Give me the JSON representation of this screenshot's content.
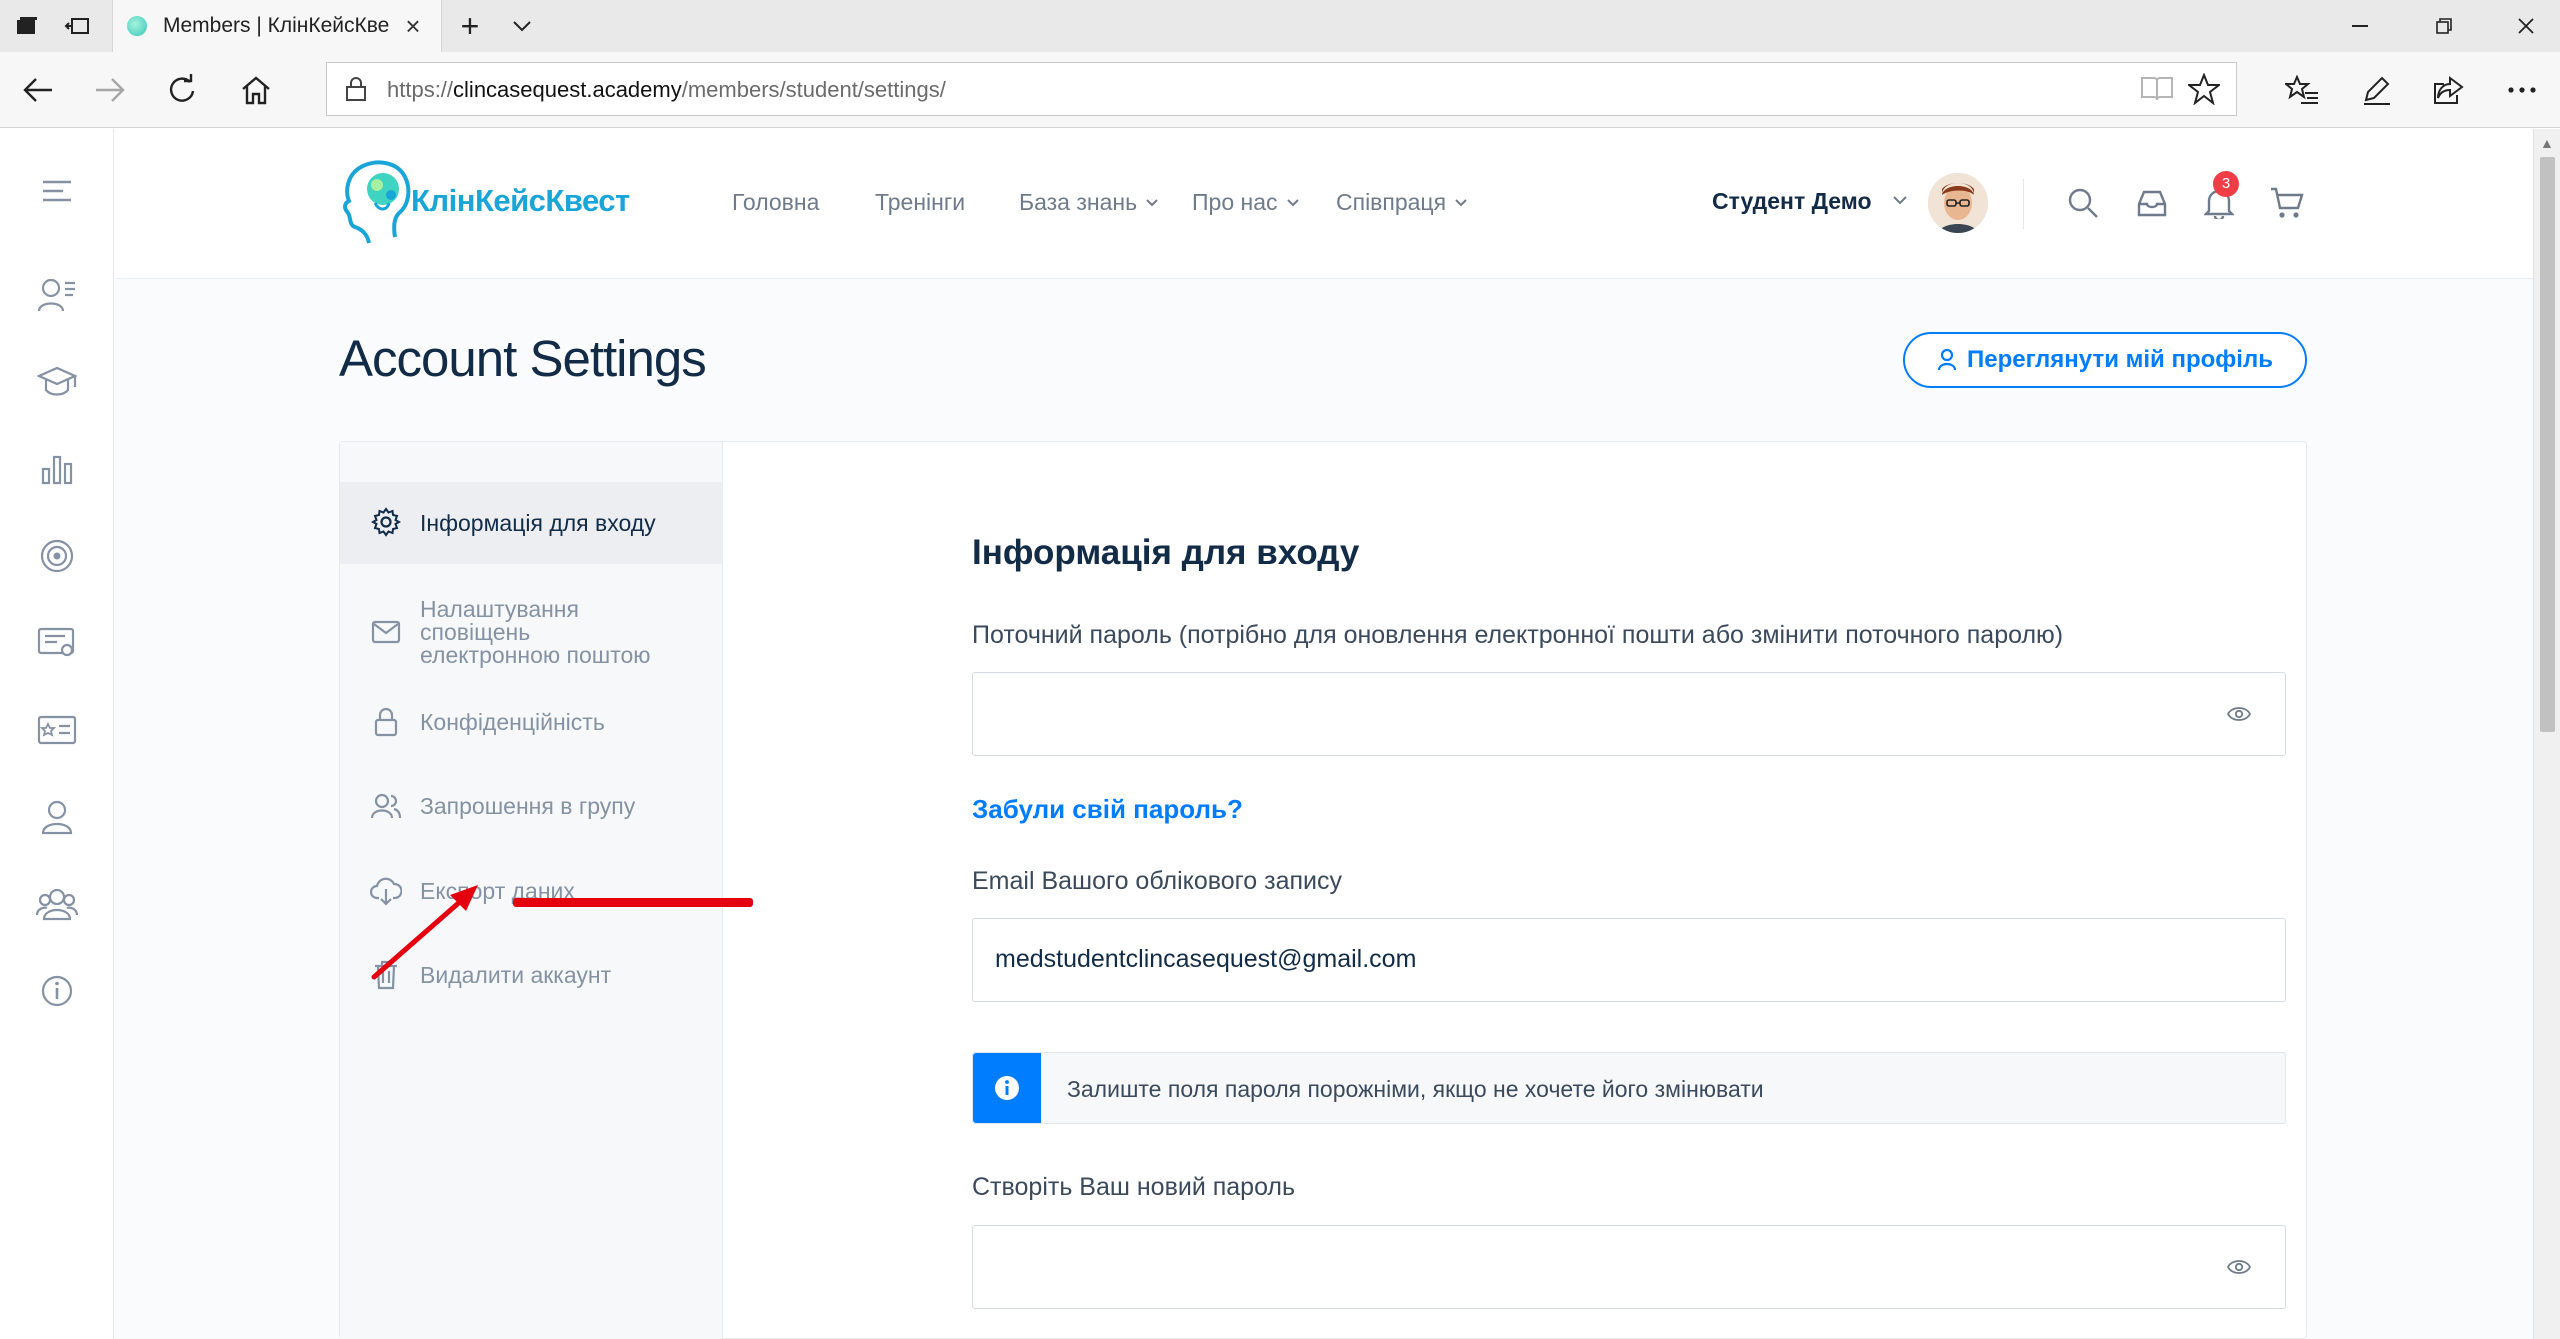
{
  "browser": {
    "tab_title": "Members | КлінКейсКве",
    "tab_close": "×",
    "new_tab": "+",
    "url_prefix": "https://",
    "url_domain": "clincasequest.academy",
    "url_path": "/members/student/settings/"
  },
  "site": {
    "logo_text": "КлінКейсКвест",
    "nav": [
      {
        "label": "Головна",
        "has_dropdown": false
      },
      {
        "label": "Тренінги",
        "has_dropdown": false
      },
      {
        "label": "База знань",
        "has_dropdown": true
      },
      {
        "label": "Про нас",
        "has_dropdown": true
      },
      {
        "label": "Співпраця",
        "has_dropdown": true
      }
    ],
    "user_name": "Студент Демо",
    "notification_count": "3"
  },
  "page": {
    "title": "Account Settings",
    "profile_button": "Переглянути мій профіль"
  },
  "settings_nav": [
    {
      "label": "Інформація для входу",
      "icon": "gear-icon",
      "active": true
    },
    {
      "label": "Налаштування сповіщень електронною поштою",
      "icon": "envelope-icon",
      "active": false
    },
    {
      "label": "Конфіденційність",
      "icon": "lock-icon",
      "active": false
    },
    {
      "label": "Запрошення в групу",
      "icon": "users-icon",
      "active": false
    },
    {
      "label": "Експорт даних",
      "icon": "cloud-download-icon",
      "active": false
    },
    {
      "label": "Видалити аккаунт",
      "icon": "trash-icon",
      "active": false
    }
  ],
  "settings_nav_multiline": [
    "Налаштування",
    "сповіщень",
    "електронною поштою"
  ],
  "form": {
    "heading": "Інформація для входу",
    "current_password_label": "Поточний пароль (потрібно для оновлення електронної пошти або змінити поточного паролю)",
    "current_password_value": "",
    "forgot_link": "Забули свій пароль?",
    "email_label": "Email Вашого облікового запису",
    "email_value": "medstudentclincasequest@gmail.com",
    "info_notice": "Залиште поля пароля порожніми, якщо не хочете його змінювати",
    "new_password_label": "Створіть Ваш новий пароль",
    "new_password_value": ""
  },
  "colors": {
    "accent": "#007cff",
    "annotation": "#e4000f",
    "badge": "#ef3e46",
    "logo": "#1aa5d8"
  }
}
